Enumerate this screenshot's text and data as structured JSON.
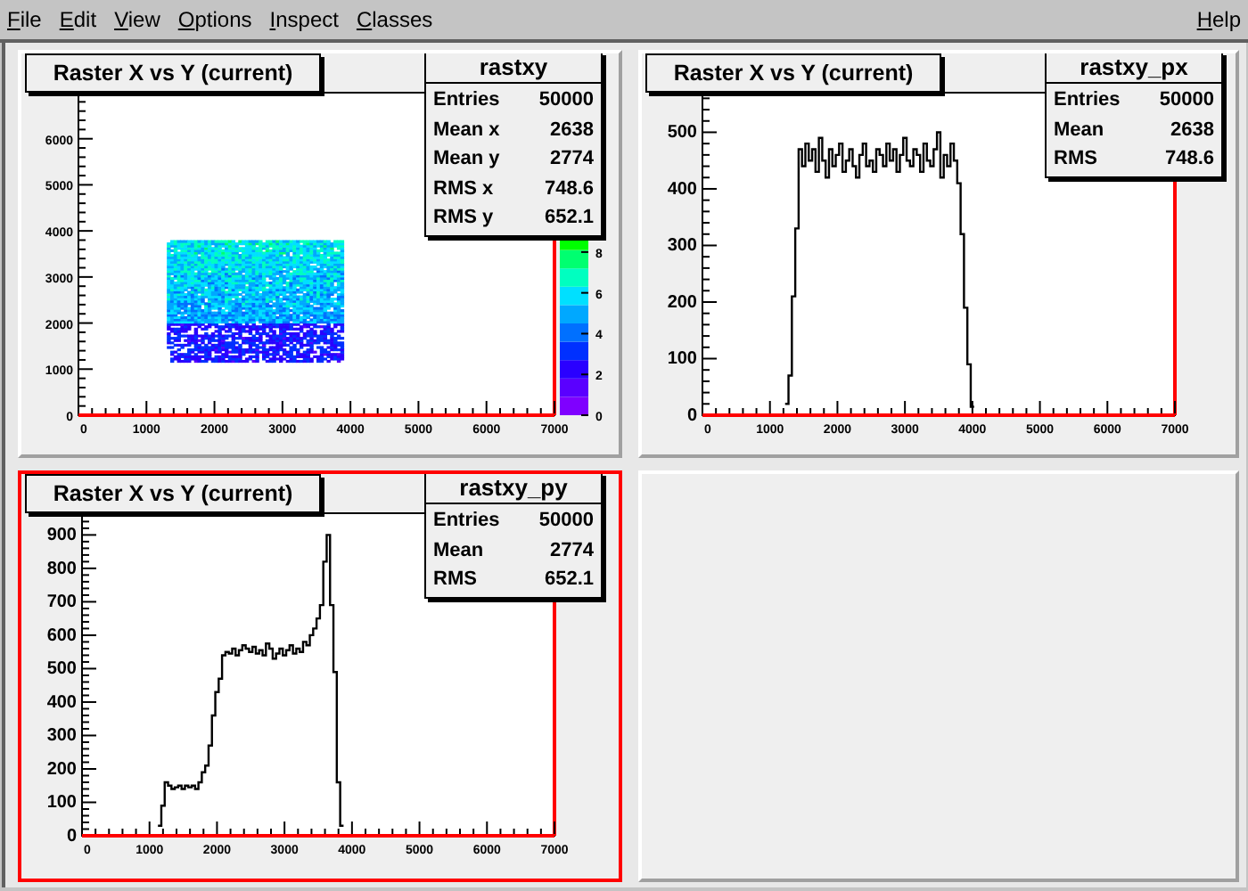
{
  "menu": [
    {
      "label": "File"
    },
    {
      "label": "Edit"
    },
    {
      "label": "View"
    },
    {
      "label": "Options"
    },
    {
      "label": "Inspect"
    },
    {
      "label": "Classes"
    }
  ],
  "help_menu": {
    "label": "Help"
  },
  "pads": [
    {
      "kind": "colz",
      "selected": false,
      "title": "Raster X vs Y (current)",
      "stats": {
        "name": "rastxy",
        "rows": [
          {
            "label": "Entries",
            "value": "50000"
          },
          {
            "label": "Mean x",
            "value": "2638"
          },
          {
            "label": "Mean y",
            "value": "2774"
          },
          {
            "label": "RMS x",
            "value": "748.6"
          },
          {
            "label": "RMS y",
            "value": "652.1"
          }
        ]
      },
      "axes": {
        "x_labels": [
          "0",
          "1000",
          "2000",
          "3000",
          "4000",
          "5000",
          "6000",
          "7000"
        ],
        "y_labels": [
          "6000",
          "5000",
          "4000",
          "3000",
          "2000",
          "1000",
          "0"
        ],
        "z_labels": [
          "8",
          "6",
          "4",
          "2",
          "0"
        ]
      }
    },
    {
      "kind": "hist",
      "selected": false,
      "title": "Raster X vs Y (current)",
      "stats": {
        "name": "rastxy_px",
        "rows": [
          {
            "label": "Entries",
            "value": "50000"
          },
          {
            "label": "Mean",
            "value": "2638"
          },
          {
            "label": "RMS",
            "value": "748.6"
          }
        ]
      },
      "chart_data": {
        "type": "line",
        "xlim": [
          0,
          7000
        ],
        "ylim": [
          0,
          570
        ],
        "xticks": [
          0,
          1000,
          2000,
          3000,
          4000,
          5000,
          6000,
          7000
        ],
        "yticks": [
          0,
          100,
          200,
          300,
          400,
          500
        ],
        "x": [
          1250,
          1300,
          1350,
          1400,
          1450,
          1500,
          1550,
          1600,
          1650,
          1700,
          1750,
          1800,
          1850,
          1900,
          1950,
          2000,
          2050,
          2100,
          2150,
          2200,
          2250,
          2300,
          2350,
          2400,
          2450,
          2500,
          2550,
          2600,
          2650,
          2700,
          2750,
          2800,
          2850,
          2900,
          2950,
          3000,
          3050,
          3100,
          3150,
          3200,
          3250,
          3300,
          3350,
          3400,
          3450,
          3500,
          3550,
          3600,
          3650,
          3700,
          3750,
          3800,
          3850,
          3900,
          3950,
          4000
        ],
        "series": [
          {
            "color": "#000000",
            "values": [
              20,
              70,
              210,
              330,
              470,
              440,
              480,
              450,
              470,
              430,
              490,
              450,
              420,
              470,
              440,
              460,
              480,
              430,
              450,
              470,
              440,
              420,
              460,
              480,
              440,
              450,
              430,
              470,
              460,
              440,
              480,
              450,
              470,
              430,
              460,
              490,
              450,
              440,
              470,
              460,
              430,
              480,
              450,
              440,
              470,
              500,
              420,
              460,
              440,
              480,
              450,
              410,
              320,
              190,
              90,
              15
            ]
          }
        ]
      }
    },
    {
      "kind": "hist",
      "selected": true,
      "title": "Raster X vs Y (current)",
      "stats": {
        "name": "rastxy_py",
        "rows": [
          {
            "label": "Entries",
            "value": "50000"
          },
          {
            "label": "Mean",
            "value": "2774"
          },
          {
            "label": "RMS",
            "value": "652.1"
          }
        ]
      },
      "chart_data": {
        "type": "line",
        "xlim": [
          0,
          7000
        ],
        "ylim": [
          0,
          965
        ],
        "xticks": [
          0,
          1000,
          2000,
          3000,
          4000,
          5000,
          6000,
          7000
        ],
        "yticks": [
          0,
          100,
          200,
          300,
          400,
          500,
          600,
          700,
          800,
          900
        ],
        "x": [
          1150,
          1200,
          1250,
          1300,
          1350,
          1400,
          1450,
          1500,
          1550,
          1600,
          1650,
          1700,
          1750,
          1800,
          1850,
          1900,
          1950,
          2000,
          2050,
          2100,
          2150,
          2200,
          2250,
          2300,
          2350,
          2400,
          2450,
          2500,
          2550,
          2600,
          2650,
          2700,
          2750,
          2800,
          2850,
          2900,
          2950,
          3000,
          3050,
          3100,
          3150,
          3200,
          3250,
          3300,
          3350,
          3400,
          3450,
          3500,
          3550,
          3600,
          3650,
          3700,
          3750,
          3800,
          3850
        ],
        "series": [
          {
            "color": "#000000",
            "values": [
              30,
              90,
              160,
              150,
              140,
              145,
              150,
              140,
              150,
              145,
              150,
              140,
              160,
              190,
              210,
              270,
              360,
              430,
              470,
              540,
              550,
              545,
              560,
              540,
              555,
              570,
              560,
              550,
              565,
              545,
              555,
              540,
              575,
              560,
              530,
              545,
              560,
              540,
              555,
              570,
              545,
              560,
              550,
              580,
              570,
              600,
              620,
              650,
              690,
              820,
              900,
              690,
              490,
              160,
              30
            ]
          }
        ]
      }
    },
    {
      "kind": "empty",
      "selected": false
    }
  ]
}
